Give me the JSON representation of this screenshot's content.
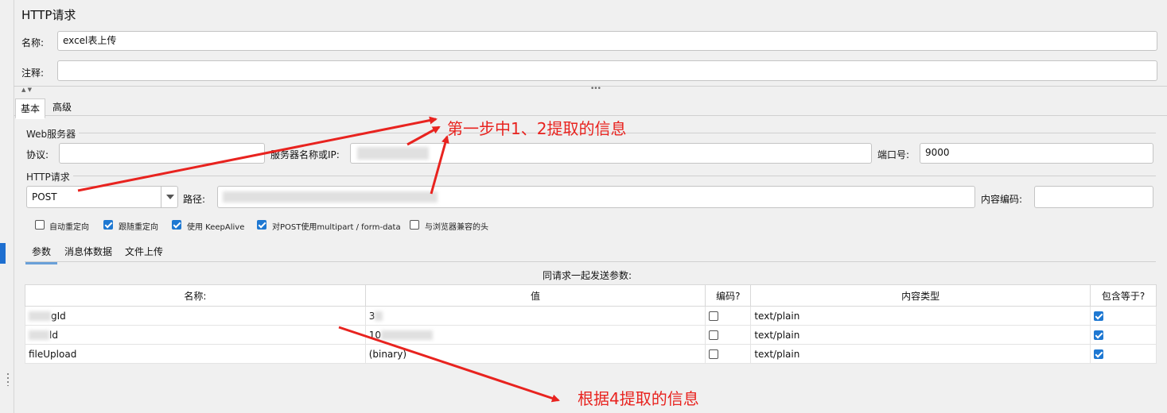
{
  "title": "HTTP请求",
  "name": {
    "label": "名称:",
    "value": "excel表上传"
  },
  "comment": {
    "label": "注释:",
    "value": ""
  },
  "tabs": [
    "基本",
    "高级"
  ],
  "web_server": {
    "group_title": "Web服务器",
    "protocol_label": "协议:",
    "protocol_value": "",
    "server_label": "服务器名称或IP:",
    "server_value": "",
    "port_label": "端口号:",
    "port_value": "9000"
  },
  "http_request": {
    "group_title": "HTTP请求",
    "method": "POST",
    "path_label": "路径:",
    "path_value": "",
    "encoding_label": "内容编码:",
    "encoding_value": ""
  },
  "options": [
    {
      "label": "自动重定向",
      "checked": false
    },
    {
      "label": "跟随重定向",
      "checked": true
    },
    {
      "label": "使用 KeepAlive",
      "checked": true
    },
    {
      "label": "对POST使用multipart / form-data",
      "checked": true
    },
    {
      "label": "与浏览器兼容的头",
      "checked": false
    }
  ],
  "param_tabs": [
    "参数",
    "消息体数据",
    "文件上传"
  ],
  "params_caption": "同请求一起发送参数:",
  "table": {
    "headers": [
      "名称:",
      "值",
      "编码?",
      "内容类型",
      "包含等于?"
    ],
    "rows": [
      {
        "name": "gId",
        "value": "3",
        "encode": false,
        "content_type": "text/plain",
        "include_equals": true
      },
      {
        "name": "ld",
        "value": "10",
        "encode": false,
        "content_type": "text/plain",
        "include_equals": true
      },
      {
        "name": "fileUpload",
        "value": "(binary)",
        "encode": false,
        "content_type": "text/plain",
        "include_equals": true
      }
    ]
  },
  "annotations": {
    "top": "第一步中1、2提取的信息",
    "bottom": "根据4提取的信息"
  },
  "colors": {
    "accent": "#1e78d2",
    "annotation": "#e8231f"
  }
}
